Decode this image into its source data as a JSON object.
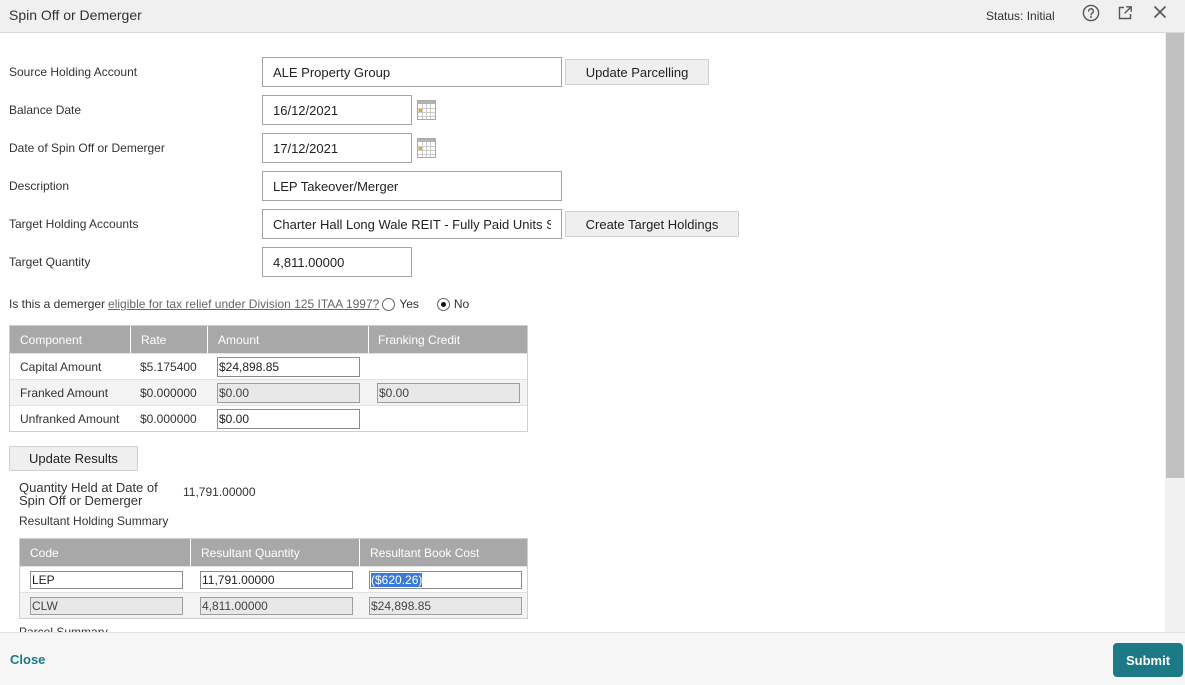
{
  "window": {
    "title": "Spin Off or Demerger",
    "status": "Status: Initial"
  },
  "icons": {
    "help": "help-icon",
    "popout": "external-link-icon",
    "close": "close-icon",
    "calendar": "calendar-icon"
  },
  "colors": {
    "accent": "#1b7a86",
    "table_header": "#a8a8a8",
    "selection": "#3a7bd5"
  },
  "form": {
    "source_holding_account": {
      "label": "Source Holding Account",
      "value": "ALE Property Group"
    },
    "update_parcelling_button": "Update Parcelling",
    "balance_date": {
      "label": "Balance Date",
      "value": "16/12/2021"
    },
    "spin_off_date": {
      "label": "Date of Spin Off or Demerger",
      "value": "17/12/2021"
    },
    "description": {
      "label": "Description",
      "value": "LEP Takeover/Merger"
    },
    "target_holding_accounts": {
      "label": "Target Holding Accounts",
      "value": "Charter Hall Long Wale REIT - Fully Paid Units Sta"
    },
    "create_target_holdings_button": "Create Target Holdings",
    "target_quantity": {
      "label": "Target Quantity",
      "value": "4,811.00000"
    }
  },
  "demerger_question": {
    "prefix": "Is this a demerger",
    "link": "eligible for tax relief under Division 125 ITAA 1997?",
    "options": [
      {
        "label": "Yes",
        "checked": false
      },
      {
        "label": "No",
        "checked": true
      }
    ]
  },
  "components": {
    "headers": [
      "Component",
      "Rate",
      "Amount",
      "Franking Credit"
    ],
    "rows": [
      {
        "component": "Capital Amount",
        "rate": "$5.175400",
        "amount": "$24,898.85",
        "amount_editable": true
      },
      {
        "component": "Franked Amount",
        "rate": "$0.000000",
        "amount": "$0.00",
        "amount_editable": false,
        "franking_credit": "$0.00"
      },
      {
        "component": "Unfranked Amount",
        "rate": "$0.000000",
        "amount": "$0.00",
        "amount_editable": true
      }
    ]
  },
  "update_results_button": "Update Results",
  "quantity_held": {
    "label": "Quantity Held at Date of Spin Off or Demerger",
    "value": "11,791.00000"
  },
  "resultant_summary": {
    "title": "Resultant Holding Summary",
    "headers": [
      "Code",
      "Resultant Quantity",
      "Resultant Book Cost"
    ],
    "rows": [
      {
        "code": "LEP",
        "quantity": "11,791.00000",
        "book_cost": "($620.26)",
        "editable": true,
        "book_cost_selected": true
      },
      {
        "code": "CLW",
        "quantity": "4,811.00000",
        "book_cost": "$24,898.85",
        "editable": false
      }
    ]
  },
  "parcel_summary_title": "Parcel Summary",
  "footer": {
    "close": "Close",
    "submit": "Submit"
  }
}
